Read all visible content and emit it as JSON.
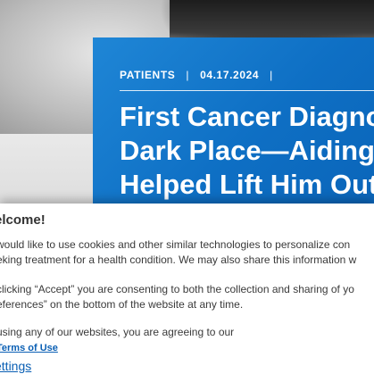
{
  "article": {
    "category": "PATIENTS",
    "separator": "|",
    "date": "04.17.2024",
    "trailing_separator": "|",
    "title_lines": [
      "First Cancer Diagno",
      "Dark Place—Aiding",
      "Helped Lift Him Out"
    ]
  },
  "consent": {
    "heading": "elcome!",
    "paragraph1": [
      "would like to use cookies and other similar technologies to personalize con",
      "eking treatment for a health condition. We may also share this information w"
    ],
    "paragraph2": [
      "clicking “Accept” you are consenting to both the collection and sharing of yo",
      "eferences” on the bottom of the website at any time."
    ],
    "paragraph3_prefix": "using any of our websites, you are agreeing to our ",
    "terms_link": "Terms of Use",
    "paragraph3_suffix": ".",
    "settings_link": "ettings"
  },
  "colors": {
    "card_blue": "#0e6fc4",
    "link_blue": "#0a5fb4",
    "text": "#3a3a3a"
  }
}
